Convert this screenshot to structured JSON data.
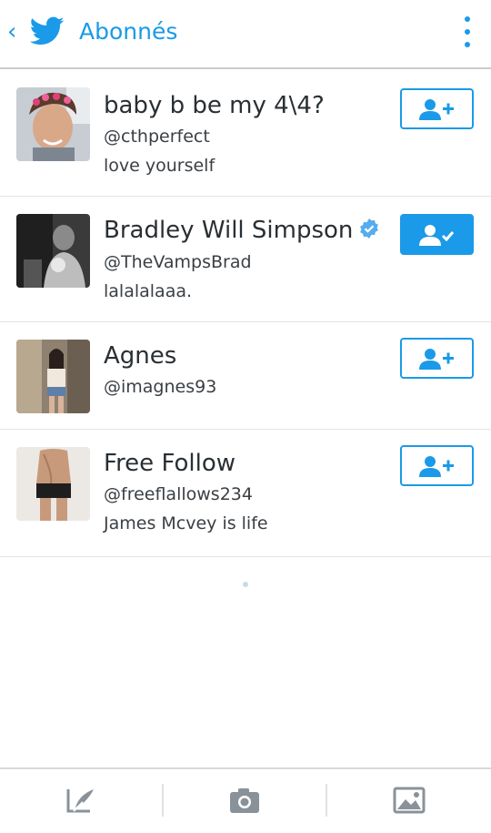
{
  "header": {
    "back_glyph": "‹",
    "title": "Abonnés",
    "accent": "#1a9ae8"
  },
  "followers": [
    {
      "name": "baby b be my 4\\4?",
      "handle": "@cthperfect",
      "bio": "love yourself",
      "verified": false,
      "following": false
    },
    {
      "name": "Bradley Will Simpson",
      "handle": "@TheVampsBrad",
      "bio": "lalalalaaa.",
      "verified": true,
      "following": true
    },
    {
      "name": "Agnes",
      "handle": "@imagnes93",
      "bio": "",
      "verified": false,
      "following": false
    },
    {
      "name": "Free Follow",
      "handle": "@freeflallows234",
      "bio": "James Mcvey is life",
      "verified": false,
      "following": false
    }
  ],
  "bottom_bar": {
    "icons": [
      "compose-tweet-icon",
      "camera-icon",
      "gallery-icon"
    ]
  }
}
